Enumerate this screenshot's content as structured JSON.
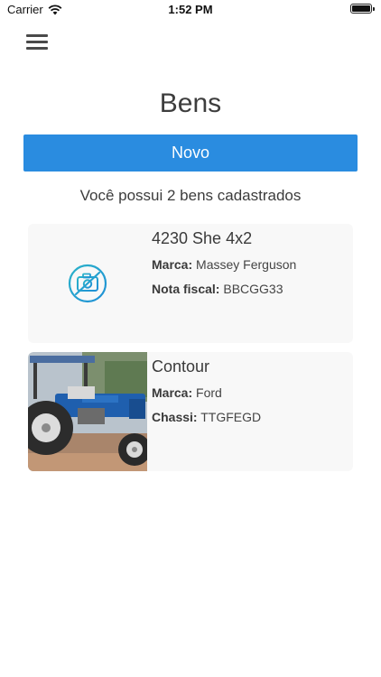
{
  "status_bar": {
    "carrier": "Carrier",
    "time": "1:52 PM"
  },
  "header": {
    "menu_icon": "hamburger-menu-icon"
  },
  "page": {
    "title": "Bens",
    "new_button_label": "Novo",
    "summary": "Você possui 2 bens cadastrados",
    "accent_color": "#2a8ce0"
  },
  "assets": [
    {
      "title": "4230 She 4x2",
      "image": "no-photo-icon",
      "fields": [
        {
          "label": "Marca:",
          "value": "Massey Ferguson"
        },
        {
          "label": "Nota fiscal:",
          "value": "BBCGG33"
        }
      ]
    },
    {
      "title": "Contour",
      "image": "tractor-photo",
      "fields": [
        {
          "label": "Marca:",
          "value": "Ford"
        },
        {
          "label": "Chassi:",
          "value": "TTGFEGD"
        }
      ]
    }
  ]
}
